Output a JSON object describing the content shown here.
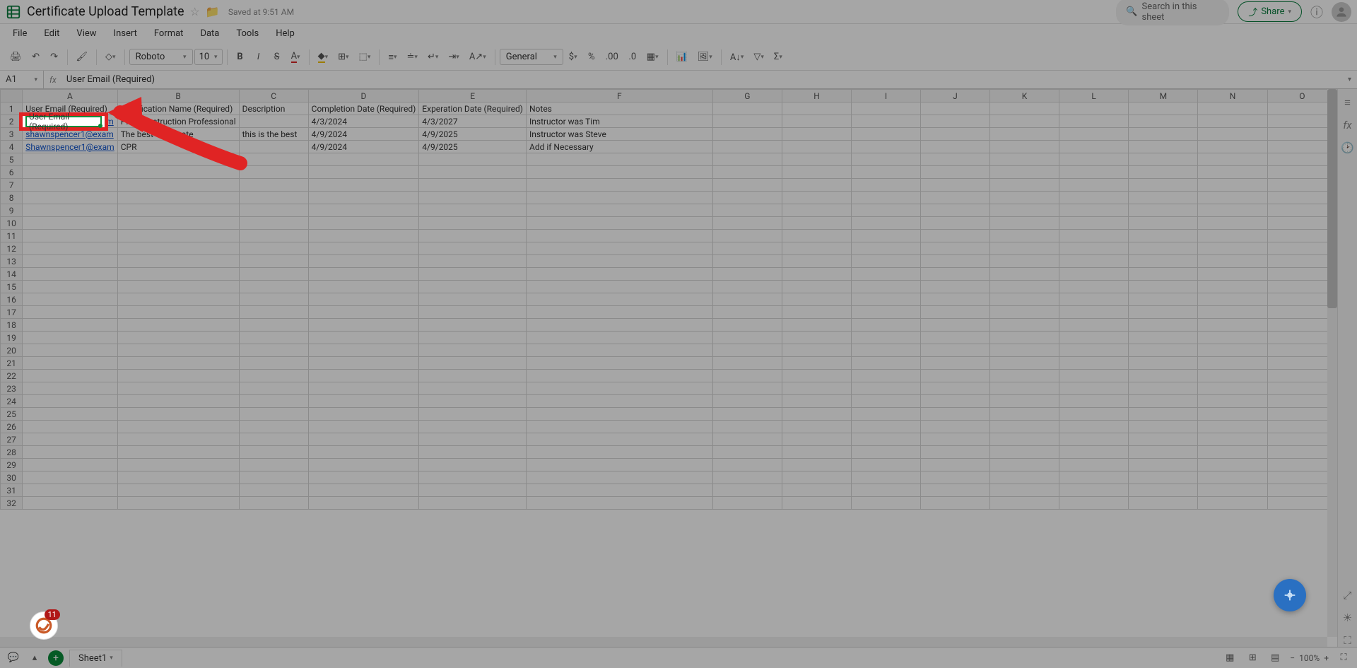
{
  "title": "Certificate Upload Template",
  "saved_text": "Saved at 9:51 AM",
  "search_placeholder": "Search in this sheet",
  "share_label": "Share",
  "menus": [
    "File",
    "Edit",
    "View",
    "Insert",
    "Format",
    "Data",
    "Tools",
    "Help"
  ],
  "font_name": "Roboto",
  "font_size": "10",
  "num_format": "General",
  "name_box": "A1",
  "formula_value": "User Email (Required)",
  "col_letters": [
    "A",
    "B",
    "C",
    "D",
    "E",
    "F",
    "G",
    "H",
    "I",
    "J",
    "K",
    "L",
    "M",
    "N",
    "O"
  ],
  "row_count": 32,
  "headers": {
    "A": "User Email (Required)",
    "B": "Certification Name (Required)",
    "C": "Description",
    "D": "Completion Date (Required)",
    "E": "Experation Date (Required)",
    "F": "Notes"
  },
  "rows": [
    {
      "A": "shawnspencer1@exam",
      "A_link": true,
      "B": "PMI Construction Professional",
      "C": "",
      "D": "4/3/2024",
      "E": "4/3/2027",
      "F": "Instructor was Tim"
    },
    {
      "A": "shawnspencer1@exam",
      "A_link": true,
      "B": "The best certificate",
      "C": "this is the best",
      "D": "4/9/2024",
      "E": "4/9/2025",
      "F": "Instructor was Steve"
    },
    {
      "A": "Shawnspencer1@exam",
      "A_link": true,
      "B": "CPR",
      "C": "",
      "D": "4/9/2024",
      "E": "4/9/2025",
      "F": "Add if Necessary"
    }
  ],
  "sheet_tab": "Sheet1",
  "zoom": "100%",
  "badge_count": "11",
  "selected_cell_text": "User Email (Required)"
}
